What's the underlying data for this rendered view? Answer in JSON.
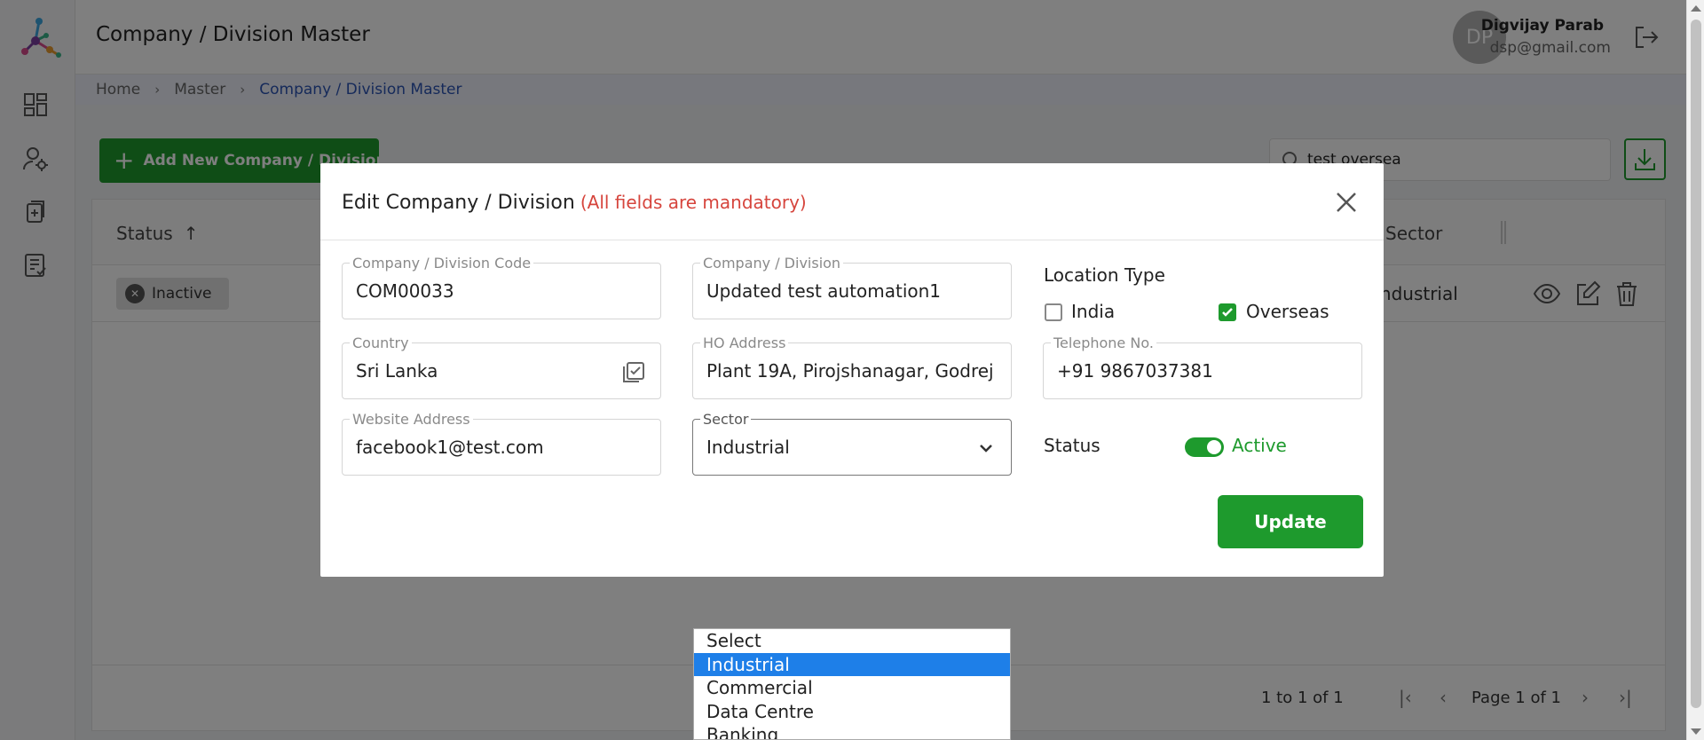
{
  "header": {
    "page_title": "Company / Division Master",
    "user_initials": "DP",
    "user_name": "Digvijay Parab",
    "user_email": "dsp@gmail.com"
  },
  "breadcrumb": [
    "Home",
    "Master",
    "Company / Division Master"
  ],
  "toolbar": {
    "add_button_label": "Add New Company / Division",
    "search_value": "test oversea"
  },
  "grid": {
    "columns": {
      "status": "Status",
      "sector": "Sector"
    },
    "rows": [
      {
        "status": "Inactive",
        "sector": "Industrial"
      }
    ],
    "pager": {
      "count_text": "1 to 1 of 1",
      "page_text": "Page 1 of 1"
    }
  },
  "modal": {
    "title": "Edit Company / Division",
    "note": "(All fields are mandatory)",
    "fields": {
      "code": {
        "label": "Company / Division Code",
        "value": "COM00033"
      },
      "name": {
        "label": "Company / Division",
        "value": "Updated test automation1"
      },
      "country": {
        "label": "Country",
        "value": "Sri Lanka"
      },
      "ho_address": {
        "label": "HO Address",
        "value": "Plant 19A, Pirojshanagar, Godrej"
      },
      "telephone": {
        "label": "Telephone No.",
        "value": "+91 9867037381"
      },
      "website": {
        "label": "Website Address",
        "value": "facebook1@test.com"
      },
      "sector": {
        "label": "Sector",
        "value": "Industrial"
      }
    },
    "location_type": {
      "label": "Location Type",
      "options": [
        {
          "label": "India",
          "checked": false
        },
        {
          "label": "Overseas",
          "checked": true
        }
      ]
    },
    "status": {
      "label": "Status",
      "value": "Active",
      "on": true
    },
    "update_label": "Update"
  },
  "sector_dropdown": {
    "options": [
      "Select",
      "Industrial",
      "Commercial",
      "Data Centre",
      "Banking"
    ],
    "selected": "Industrial"
  },
  "colors": {
    "primary_green": "#1e9a2d",
    "mandatory_red": "#d6453d",
    "breadcrumb_active": "#2c55b5",
    "dropdown_highlight": "#1e7fe8"
  }
}
